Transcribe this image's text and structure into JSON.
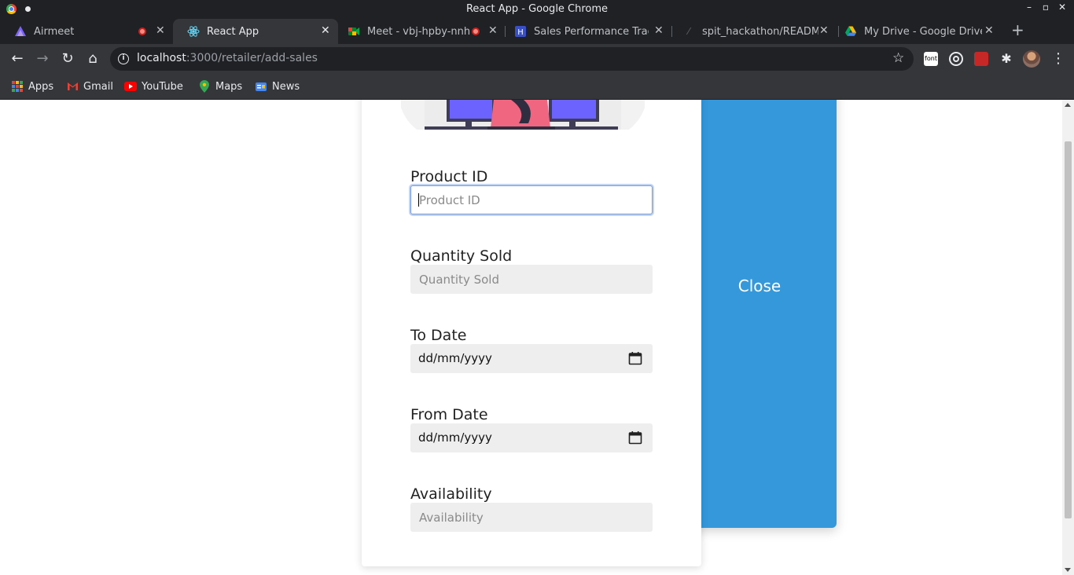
{
  "window": {
    "title": "React App - Google Chrome"
  },
  "tabs": [
    {
      "label": "Airmeet",
      "favicon": "airmeet-icon",
      "recording": true,
      "active": false
    },
    {
      "label": "React App",
      "favicon": "react-icon",
      "recording": false,
      "active": true
    },
    {
      "label": "Meet - vbj-hpby-nnh",
      "favicon": "meet-icon",
      "recording": true,
      "active": false
    },
    {
      "label": "Sales Performance Track",
      "favicon": "doc-icon",
      "recording": false,
      "active": false
    },
    {
      "label": "spit_hackathon/READMI",
      "favicon": "github-icon",
      "recording": false,
      "active": false
    },
    {
      "label": "My Drive - Google Drive",
      "favicon": "drive-icon",
      "recording": false,
      "active": false
    }
  ],
  "address_bar": {
    "host": "localhost",
    "path": ":3000/retailer/add-sales"
  },
  "extensions": {
    "font_label": "font"
  },
  "bookmarks": [
    {
      "label": "Apps",
      "icon": "apps-grid-icon"
    },
    {
      "label": "Gmail",
      "icon": "gmail-icon"
    },
    {
      "label": "YouTube",
      "icon": "youtube-icon"
    },
    {
      "label": "Maps",
      "icon": "maps-icon"
    },
    {
      "label": "News",
      "icon": "news-icon"
    }
  ],
  "form": {
    "product_id": {
      "label": "Product ID",
      "placeholder": "Product ID",
      "value": ""
    },
    "quantity_sold": {
      "label": "Quantity Sold",
      "placeholder": "Quantity Sold",
      "value": ""
    },
    "to_date": {
      "label": "To Date",
      "value": "dd/mm/yyyy"
    },
    "from_date": {
      "label": "From Date",
      "value": "dd/mm/yyyy"
    },
    "availability": {
      "label": "Availability",
      "placeholder": "Availability",
      "value": ""
    }
  },
  "side_panel": {
    "close_label": "Close",
    "color": "#3498db"
  },
  "colors": {
    "chrome_dark": "#202124",
    "chrome_toolbar": "#35363a",
    "accent_blue": "#3498db",
    "illustration_pink": "#f06580",
    "illustration_purple": "#6c63ff"
  }
}
